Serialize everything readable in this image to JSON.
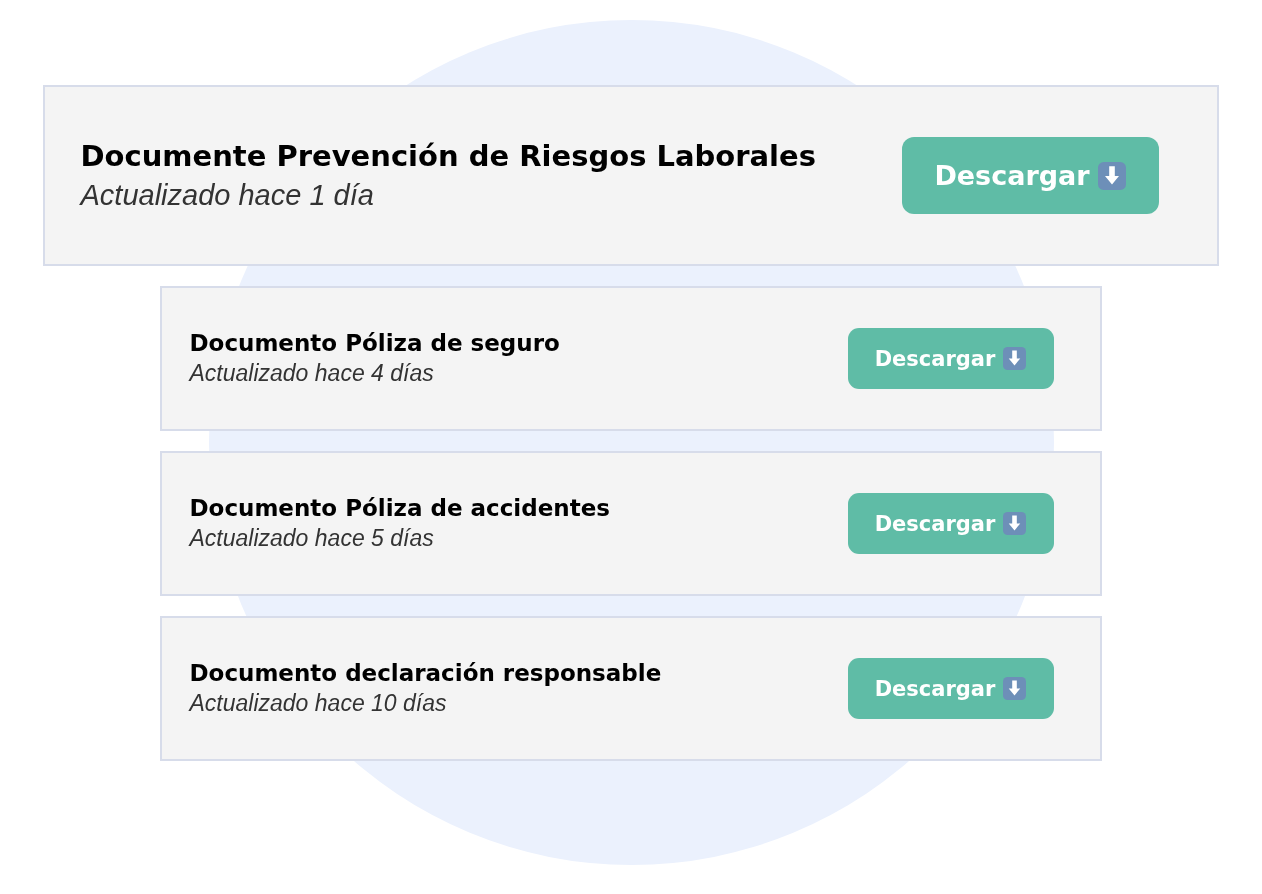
{
  "documents": [
    {
      "kind": "featured",
      "title": "Documente Prevención de Riesgos Laborales",
      "updated": "Actualizado hace 1 día",
      "button": "Descargar"
    },
    {
      "kind": "standard",
      "title": "Documento Póliza de seguro",
      "updated": "Actualizado hace 4 días",
      "button": "Descargar"
    },
    {
      "kind": "standard",
      "title": "Documento Póliza de accidentes",
      "updated": "Actualizado hace 5 días",
      "button": "Descargar"
    },
    {
      "kind": "standard",
      "title": "Documento declaración responsable",
      "updated": "Actualizado hace 10 días",
      "button": "Descargar"
    }
  ]
}
